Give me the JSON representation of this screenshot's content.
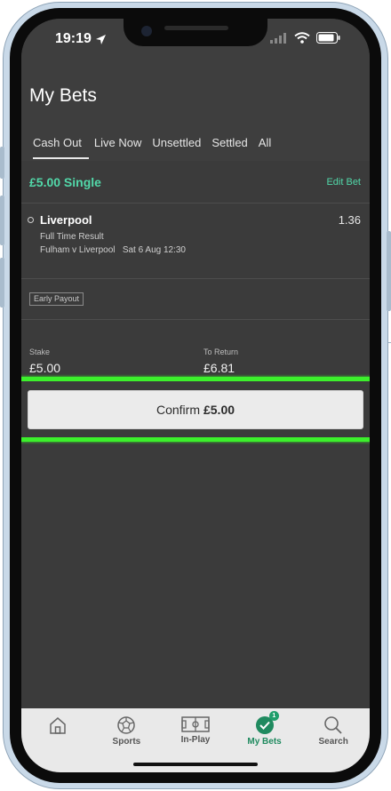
{
  "status_bar": {
    "time": "19:19"
  },
  "header": {
    "title": "My Bets",
    "tabs": [
      {
        "label": "Cash Out",
        "active": true
      },
      {
        "label": "Live Now",
        "active": false
      },
      {
        "label": "Unsettled",
        "active": false
      },
      {
        "label": "Settled",
        "active": false
      },
      {
        "label": "All",
        "active": false
      }
    ]
  },
  "bet": {
    "title": "£5.00 Single",
    "edit_label": "Edit Bet",
    "selection": "Liverpool",
    "odds": "1.36",
    "market": "Full Time Result",
    "event": "Fulham v Liverpool   Sat 6 Aug 12:30",
    "badge": "Early Payout",
    "stake_label": "Stake",
    "stake_value": "£5.00",
    "return_label": "To Return",
    "return_value": "£6.81",
    "confirm_label": "Confirm",
    "confirm_amount": "£5.00"
  },
  "nav": {
    "items": [
      {
        "label": "",
        "icon": "home-icon"
      },
      {
        "label": "Sports",
        "icon": "football-icon"
      },
      {
        "label": "In-Play",
        "icon": "pitch-icon"
      },
      {
        "label": "My Bets",
        "icon": "check-circle-icon",
        "badge": "1",
        "active": true
      },
      {
        "label": "Search",
        "icon": "search-icon"
      }
    ]
  },
  "colors": {
    "accent": "#52d8a9",
    "highlight": "#3cf02c",
    "nav_active": "#1f8a5f"
  }
}
